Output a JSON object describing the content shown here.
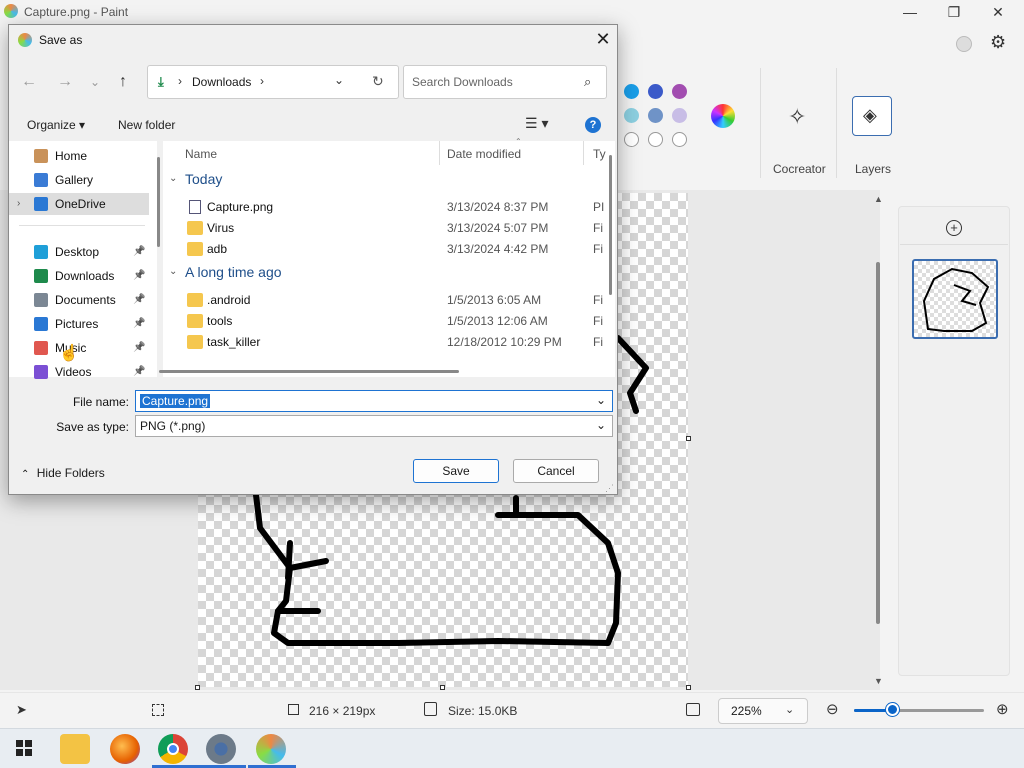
{
  "app": {
    "title": "Capture.png - Paint"
  },
  "ribbon": {
    "cocreator_label": "Cocreator",
    "layers_label": "Layers",
    "swatches": [
      "#1a9ee8",
      "#3b5ac9",
      "#a24db0",
      "#8ccfe0",
      "#6f93c7",
      "#c8bde6",
      "#ffffff",
      "#ffffff",
      "#ffffff"
    ]
  },
  "status": {
    "canvas_size": "216 × 219px",
    "file_size": "Size: 15.0KB",
    "zoom": "225%"
  },
  "dialog": {
    "title": "Save as",
    "address": {
      "location": "Downloads"
    },
    "search_placeholder": "Search Downloads",
    "toolbar": {
      "organize": "Organize",
      "new_folder": "New folder"
    },
    "nav_items": [
      {
        "label": "Home",
        "icon": "home-icon",
        "pinned": false
      },
      {
        "label": "Gallery",
        "icon": "gallery-icon",
        "pinned": false
      },
      {
        "label": "OneDrive",
        "icon": "cloud-icon",
        "pinned": false,
        "selected": true
      },
      {
        "label": "Desktop",
        "icon": "desktop-icon",
        "pinned": true
      },
      {
        "label": "Downloads",
        "icon": "download-icon",
        "pinned": true
      },
      {
        "label": "Documents",
        "icon": "documents-icon",
        "pinned": true
      },
      {
        "label": "Pictures",
        "icon": "pictures-icon",
        "pinned": true
      },
      {
        "label": "Music",
        "icon": "music-icon",
        "pinned": true
      },
      {
        "label": "Videos",
        "icon": "videos-icon",
        "pinned": true
      }
    ],
    "columns": {
      "name": "Name",
      "date": "Date modified",
      "type": "Ty"
    },
    "groups": [
      {
        "label": "Today",
        "files": [
          {
            "name": "Capture.png",
            "date": "3/13/2024 8:37 PM",
            "type": "PI",
            "kind": "file"
          },
          {
            "name": "Virus",
            "date": "3/13/2024 5:07 PM",
            "type": "Fi",
            "kind": "folder"
          },
          {
            "name": "adb",
            "date": "3/13/2024 4:42 PM",
            "type": "Fi",
            "kind": "folder"
          }
        ]
      },
      {
        "label": "A long time ago",
        "files": [
          {
            "name": ".android",
            "date": "1/5/2013 6:05 AM",
            "type": "Fi",
            "kind": "folder"
          },
          {
            "name": "tools",
            "date": "1/5/2013 12:06 AM",
            "type": "Fi",
            "kind": "folder"
          },
          {
            "name": "task_killer",
            "date": "12/18/2012 10:29 PM",
            "type": "Fi",
            "kind": "folder"
          }
        ]
      }
    ],
    "file_name_label": "File name:",
    "file_name_value": "Capture.png",
    "save_type_label": "Save as type:",
    "save_type_value": "PNG (*.png)",
    "hide_folders": "Hide Folders",
    "save_button": "Save",
    "cancel_button": "Cancel"
  }
}
